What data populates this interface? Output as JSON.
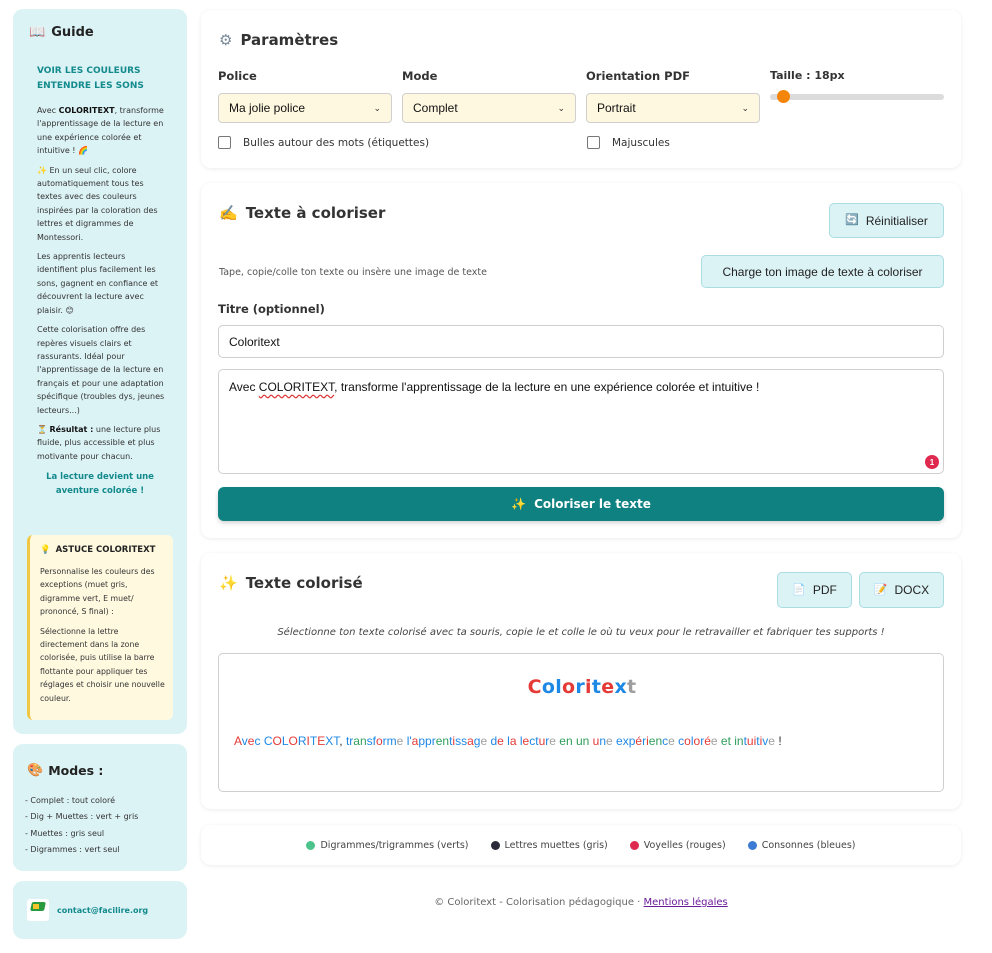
{
  "sidebar": {
    "guide_title": "Guide",
    "guide_icon": "book-icon",
    "guide_sub_line1": "VOIR LES COULEURS",
    "guide_sub_line2": "ENTENDRE LES SONS",
    "p1_pre": "Avec ",
    "p1_brand": "COLORITEXT",
    "p1_post": ", transforme l'apprentissage de la lecture en une expérience colorée et intuitive ! 🌈",
    "p2": "✨ En un seul clic, colore automatiquement tous tes textes avec des couleurs inspirées par la coloration des lettres et digrammes de Montessori.",
    "p3": "Les apprentis lecteurs identifient plus facilement les sons, gagnent en confiance et découvrent la lecture avec plaisir. 😊",
    "p4": "Cette colorisation offre des repères visuels clairs et rassurants. Idéal pour l'apprentissage de la lecture en français et pour une adaptation spécifique (troubles dys, jeunes lecteurs...)",
    "p5_icon": "⏳",
    "p5_label": "Résultat :",
    "p5_text": " une lecture plus fluide, plus accessible et plus motivante pour chacun.",
    "tagline": "La lecture devient une aventure colorée !",
    "tip_icon": "💡",
    "tip_title": "ASTUCE COLORITEXT",
    "tip_p1": "Personnalise les couleurs des exceptions (muet gris, digramme vert, E muet/ prononcé, S final) :",
    "tip_p2": "Sélectionne la lettre directement dans la zone colorisée, puis utilise la barre flottante pour appliquer tes réglages et choisir une nouvelle couleur.",
    "modes_icon": "🎨",
    "modes_title": "Modes :",
    "modes": [
      "- Complet : tout coloré",
      "- Dig + Muettes : vert + gris",
      "- Muettes : gris seul",
      "- Digrammes : vert seul"
    ],
    "contact": "contact@facilire.org"
  },
  "params": {
    "icon": "⚙️",
    "title": "Paramètres",
    "police_label": "Police",
    "police_value": "Ma jolie police",
    "mode_label": "Mode",
    "mode_value": "Complet",
    "orientation_label": "Orientation PDF",
    "orientation_value": "Portrait",
    "size_label": "Taille : 18px",
    "size_level": 0.05,
    "bubbles_label": "Bulles autour des mots (étiquettes)",
    "uppercase_label": "Majuscules"
  },
  "input": {
    "icon": "✍️",
    "title": "Texte à coloriser",
    "reset_icon": "🔄",
    "reset_label": "Réinitialiser",
    "hint": "Tape, copie/colle ton texte ou insère une image de texte",
    "upload_label": "Charge ton image de texte à coloriser",
    "title_field_label": "Titre (optionnel)",
    "title_value": "Coloritext",
    "text_pre": "Avec ",
    "text_flag": "COLORITEXT",
    "text_post": ", transforme l'apprentissage de la lecture en une expérience colorée et intuitive !",
    "error_count": "1",
    "colorize_icon": "✨",
    "colorize_label": "Coloriser le texte"
  },
  "output": {
    "icon": "✨",
    "title": "Texte colorisé",
    "pdf_icon": "📄",
    "pdf_label": "PDF",
    "docx_icon": "📝",
    "docx_label": "DOCX",
    "instruction": "Sélectionne ton texte colorisé avec ta souris, copie le et colle le où tu veux pour le retravailler et fabriquer tes supports !",
    "logo_letters": [
      {
        "t": "C",
        "c": "#e53935"
      },
      {
        "t": "o",
        "c": "#1e88e5"
      },
      {
        "t": "l",
        "c": "#1e88e5"
      },
      {
        "t": "o",
        "c": "#e53935"
      },
      {
        "t": "r",
        "c": "#1e88e5"
      },
      {
        "t": "i",
        "c": "#e53935"
      },
      {
        "t": "t",
        "c": "#1e88e5"
      },
      {
        "t": "e",
        "c": "#e53935"
      },
      {
        "t": "x",
        "c": "#1e88e5"
      },
      {
        "t": "t",
        "c": "#9e9e9e"
      }
    ],
    "colored_words": [
      {
        "t": "A",
        "c": "#e53935"
      },
      {
        "t": "v",
        "c": "#1e88e5"
      },
      {
        "t": "e",
        "c": "#e53935"
      },
      {
        "t": "c ",
        "c": "#1e88e5"
      },
      {
        "t": "C",
        "c": "#1e88e5"
      },
      {
        "t": "O",
        "c": "#e53935"
      },
      {
        "t": "L",
        "c": "#1e88e5"
      },
      {
        "t": "O",
        "c": "#e53935"
      },
      {
        "t": "R",
        "c": "#1e88e5"
      },
      {
        "t": "I",
        "c": "#e53935"
      },
      {
        "t": "T",
        "c": "#1e88e5"
      },
      {
        "t": "E",
        "c": "#e53935"
      },
      {
        "t": "X",
        "c": "#1e88e5"
      },
      {
        "t": "T",
        "c": "#1e88e5"
      },
      {
        "t": ", ",
        "c": "#333333"
      },
      {
        "t": "tr",
        "c": "#1e88e5"
      },
      {
        "t": "an",
        "c": "#2e9e5b"
      },
      {
        "t": "sf",
        "c": "#1e88e5"
      },
      {
        "t": "o",
        "c": "#e53935"
      },
      {
        "t": "rm",
        "c": "#1e88e5"
      },
      {
        "t": "e ",
        "c": "#9e9e9e"
      },
      {
        "t": "l'",
        "c": "#1e88e5"
      },
      {
        "t": "a",
        "c": "#e53935"
      },
      {
        "t": "pp",
        "c": "#1e88e5"
      },
      {
        "t": "r",
        "c": "#1e88e5"
      },
      {
        "t": "en",
        "c": "#2e9e5b"
      },
      {
        "t": "t",
        "c": "#1e88e5"
      },
      {
        "t": "i",
        "c": "#e53935"
      },
      {
        "t": "ss",
        "c": "#1e88e5"
      },
      {
        "t": "a",
        "c": "#e53935"
      },
      {
        "t": "g",
        "c": "#1e88e5"
      },
      {
        "t": "e ",
        "c": "#9e9e9e"
      },
      {
        "t": "d",
        "c": "#1e88e5"
      },
      {
        "t": "e ",
        "c": "#e53935"
      },
      {
        "t": "l",
        "c": "#1e88e5"
      },
      {
        "t": "a ",
        "c": "#e53935"
      },
      {
        "t": "l",
        "c": "#1e88e5"
      },
      {
        "t": "e",
        "c": "#e53935"
      },
      {
        "t": "c",
        "c": "#1e88e5"
      },
      {
        "t": "t",
        "c": "#1e88e5"
      },
      {
        "t": "u",
        "c": "#e53935"
      },
      {
        "t": "r",
        "c": "#1e88e5"
      },
      {
        "t": "e ",
        "c": "#9e9e9e"
      },
      {
        "t": "en ",
        "c": "#2e9e5b"
      },
      {
        "t": "un ",
        "c": "#2e9e5b"
      },
      {
        "t": "u",
        "c": "#e53935"
      },
      {
        "t": "n",
        "c": "#1e88e5"
      },
      {
        "t": "e ",
        "c": "#9e9e9e"
      },
      {
        "t": "ex",
        "c": "#1e88e5"
      },
      {
        "t": "p",
        "c": "#1e88e5"
      },
      {
        "t": "é",
        "c": "#e53935"
      },
      {
        "t": "r",
        "c": "#1e88e5"
      },
      {
        "t": "i",
        "c": "#e53935"
      },
      {
        "t": "en",
        "c": "#2e9e5b"
      },
      {
        "t": "c",
        "c": "#1e88e5"
      },
      {
        "t": "e ",
        "c": "#9e9e9e"
      },
      {
        "t": "c",
        "c": "#1e88e5"
      },
      {
        "t": "o",
        "c": "#e53935"
      },
      {
        "t": "l",
        "c": "#1e88e5"
      },
      {
        "t": "o",
        "c": "#e53935"
      },
      {
        "t": "r",
        "c": "#1e88e5"
      },
      {
        "t": "é",
        "c": "#e53935"
      },
      {
        "t": "e ",
        "c": "#9e9e9e"
      },
      {
        "t": "et ",
        "c": "#2e9e5b"
      },
      {
        "t": "in",
        "c": "#2e9e5b"
      },
      {
        "t": "t",
        "c": "#1e88e5"
      },
      {
        "t": "u",
        "c": "#e53935"
      },
      {
        "t": "i",
        "c": "#e53935"
      },
      {
        "t": "t",
        "c": "#1e88e5"
      },
      {
        "t": "i",
        "c": "#e53935"
      },
      {
        "t": "v",
        "c": "#1e88e5"
      },
      {
        "t": "e",
        "c": "#9e9e9e"
      },
      {
        "t": " !",
        "c": "#333333"
      }
    ]
  },
  "legend": [
    {
      "label": "Digrammes/trigrammes (verts)",
      "color": "#4cc38a"
    },
    {
      "label": "Lettres muettes (gris)",
      "color": "#2b2b3a"
    },
    {
      "label": "Voyelles (rouges)",
      "color": "#e0294f"
    },
    {
      "label": "Consonnes (bleues)",
      "color": "#3b7bd6"
    }
  ],
  "footer": {
    "text": "© Coloritext - Colorisation pédagogique · ",
    "link": "Mentions légales"
  },
  "colors": {
    "accent": "#0f8181",
    "sidebar_bg": "#dcf3f6",
    "select_bg": "#fff8e0",
    "slider_thumb": "#f5840b"
  }
}
